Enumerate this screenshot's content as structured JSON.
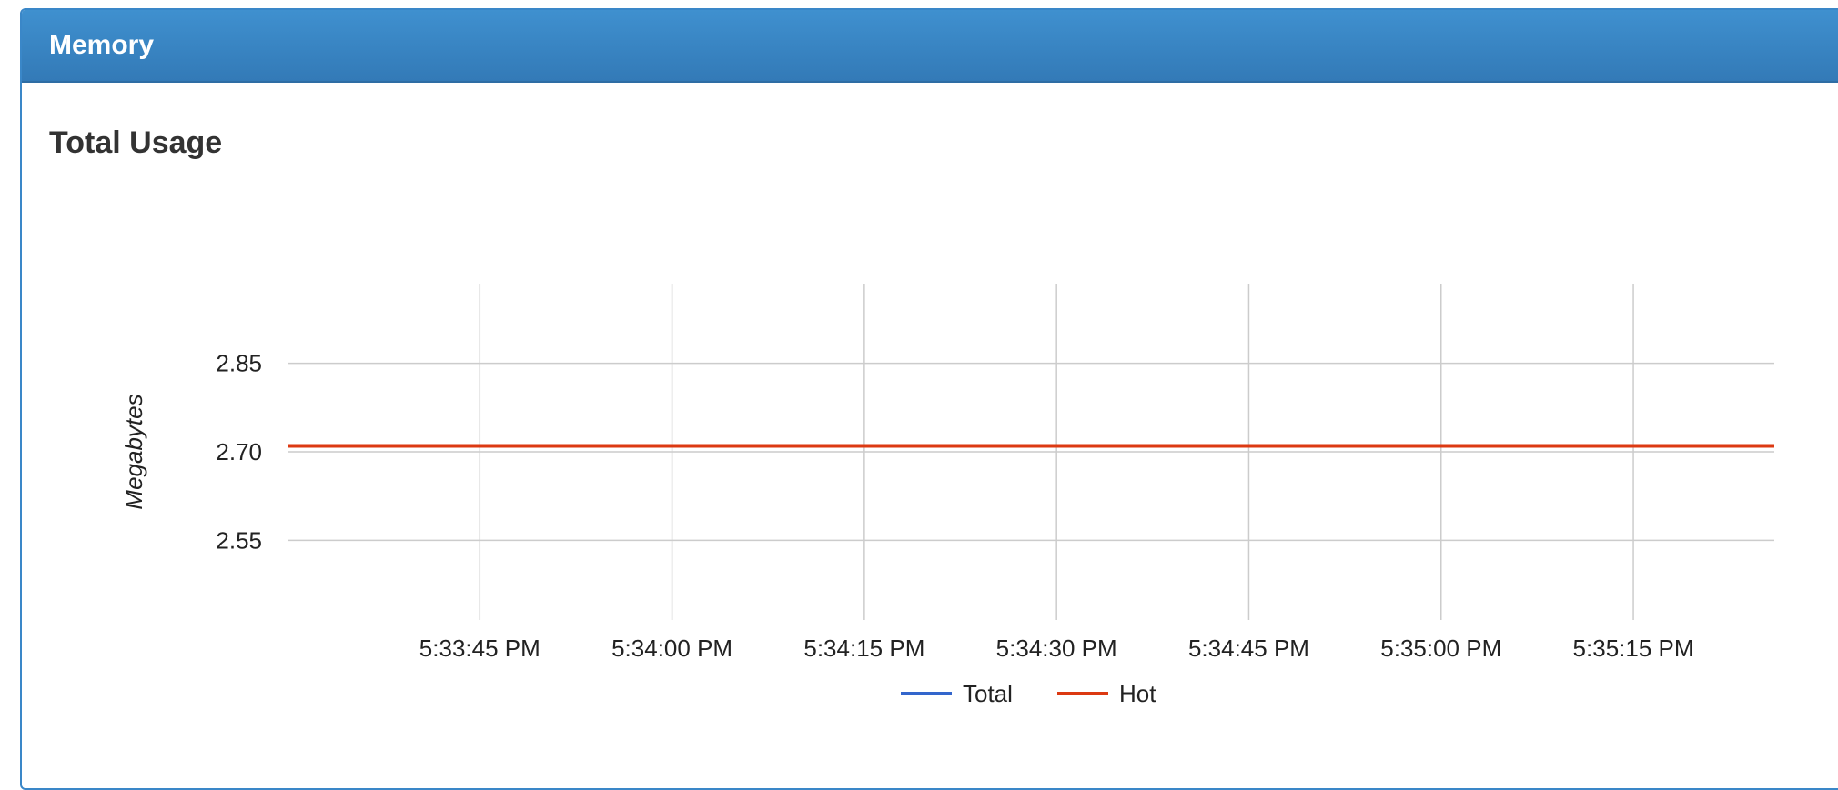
{
  "panel": {
    "title": "Memory"
  },
  "section": {
    "title": "Total Usage"
  },
  "colors": {
    "header": "#3a87c8",
    "total": "#3366cc",
    "hot": "#dc3912",
    "grid": "#cccccc"
  },
  "chart_data": {
    "type": "line",
    "ylabel": "Megabytes",
    "xlabel": "",
    "y_ticks": [
      2.55,
      2.7,
      2.85
    ],
    "y_tick_labels": [
      "2.55",
      "2.70",
      "2.85"
    ],
    "ylim": [
      2.415,
      2.985
    ],
    "x_ticks": [
      "5:33:45 PM",
      "5:34:00 PM",
      "5:34:15 PM",
      "5:34:30 PM",
      "5:34:45 PM",
      "5:35:00 PM",
      "5:35:15 PM"
    ],
    "x_range": [
      "5:33:30 PM",
      "5:35:26 PM"
    ],
    "grid": true,
    "legend_position": "bottom",
    "series": [
      {
        "name": "Total",
        "color": "#3366cc",
        "x": [
          "5:33:30 PM",
          "5:35:26 PM"
        ],
        "y": [
          2.71,
          2.71
        ]
      },
      {
        "name": "Hot",
        "color": "#dc3912",
        "x": [
          "5:33:30 PM",
          "5:35:26 PM"
        ],
        "y": [
          2.71,
          2.71
        ]
      }
    ]
  }
}
